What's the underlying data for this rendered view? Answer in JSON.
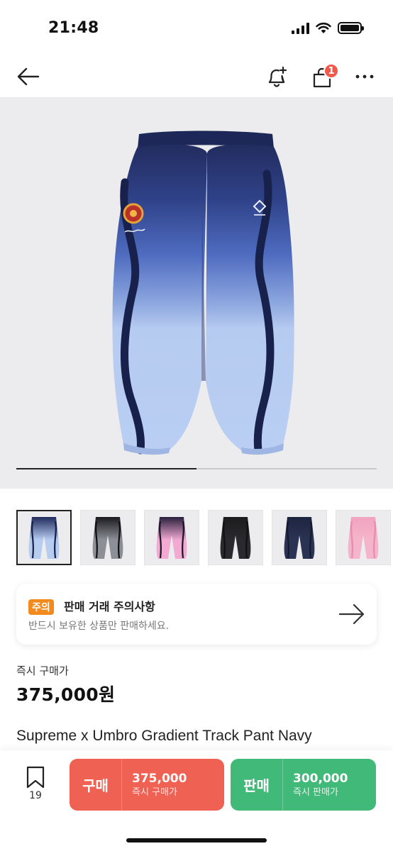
{
  "status_bar": {
    "time": "21:48"
  },
  "nav": {
    "cart_badge": "1"
  },
  "gallery": {
    "progress": 0.5,
    "thumbnails": [
      {
        "name": "thumb-navy-gradient",
        "top": "#1f2a5c",
        "bottom": "#b7cdf0",
        "stripe": "#17204a"
      },
      {
        "name": "thumb-black-gradient",
        "top": "#1a1a1e",
        "bottom": "#8d8f96",
        "stripe": "#0f0f12"
      },
      {
        "name": "thumb-pink-gradient",
        "top": "#2a1f3d",
        "bottom": "#f2a9d2",
        "stripe": "#1a1428"
      },
      {
        "name": "thumb-black-solid",
        "top": "#1c1c1f",
        "bottom": "#2a2a2e",
        "stripe": "#111"
      },
      {
        "name": "thumb-navy-solid",
        "top": "#1e2540",
        "bottom": "#2b3354",
        "stripe": "#141a30"
      },
      {
        "name": "thumb-pink-solid",
        "top": "#f2a3bf",
        "bottom": "#f4b5ca",
        "stripe": "#e88aae"
      }
    ],
    "active_index": 0
  },
  "notice": {
    "tag": "주의",
    "title": "판매 거래 주의사항",
    "subtitle": "반드시 보유한 상품만 판매하세요."
  },
  "price": {
    "label": "즉시 구매가",
    "value": "375,000원"
  },
  "product": {
    "name": "Supreme x Umbro Gradient Track Pant Navy"
  },
  "bottom_bar": {
    "bookmark_count": "19",
    "buy": {
      "label": "구매",
      "price": "375,000",
      "sub": "즉시 구매가",
      "color": "#ef6253"
    },
    "sell": {
      "label": "판매",
      "price": "300,000",
      "sub": "즉시 판매가",
      "color": "#41b978"
    }
  }
}
